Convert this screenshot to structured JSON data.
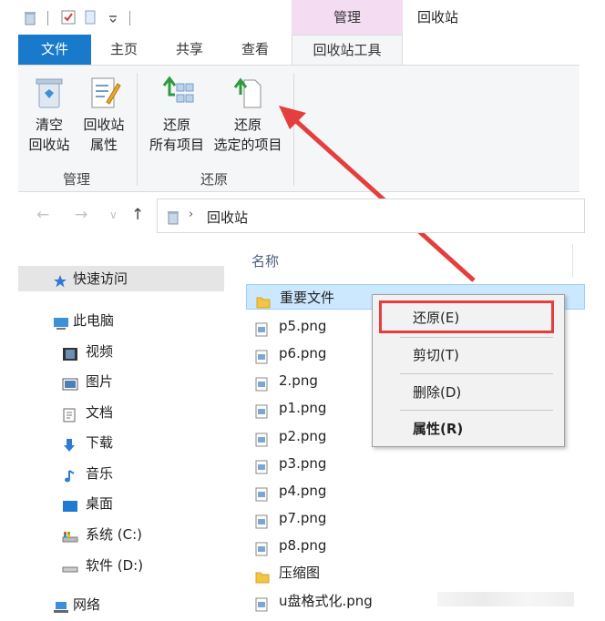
{
  "titlebar": {
    "context_group": "管理",
    "window_title": "回收站"
  },
  "tabs": {
    "file": "文件",
    "home": "主页",
    "share": "共享",
    "view": "查看",
    "recycle_tools": "回收站工具"
  },
  "ribbon": {
    "empty_bin": "清空\n回收站",
    "empty_bin_l1": "清空",
    "empty_bin_l2": "回收站",
    "bin_props_l1": "回收站",
    "bin_props_l2": "属性",
    "group_manage": "管理",
    "restore_all_l1": "还原",
    "restore_all_l2": "所有项目",
    "restore_sel_l1": "还原",
    "restore_sel_l2": "选定的项目",
    "group_restore": "还原"
  },
  "address": {
    "path": "回收站"
  },
  "nav": {
    "quick_access": "快速访问",
    "this_pc": "此电脑",
    "videos": "视频",
    "pictures": "图片",
    "documents": "文档",
    "downloads": "下载",
    "music": "音乐",
    "desktop": "桌面",
    "drive_c": "系统 (C:)",
    "drive_d": "软件 (D:)",
    "network": "网络"
  },
  "filelist": {
    "col_name": "名称",
    "files": [
      "重要文件",
      "p5.png",
      "p6.png",
      "2.png",
      "p1.png",
      "p2.png",
      "p3.png",
      "p4.png",
      "p7.png",
      "p8.png",
      "压缩图",
      "u盘格式化.png"
    ]
  },
  "context_menu": {
    "restore": "还原(E)",
    "cut": "剪切(T)",
    "delete": "删除(D)",
    "properties": "属性(R)"
  },
  "colors": {
    "accent_blue": "#1979ca",
    "context_tab": "#f4dcf3",
    "highlight_red": "#e53e3e",
    "arrow_red": "#e53e3e",
    "selection": "#cce8ff"
  }
}
